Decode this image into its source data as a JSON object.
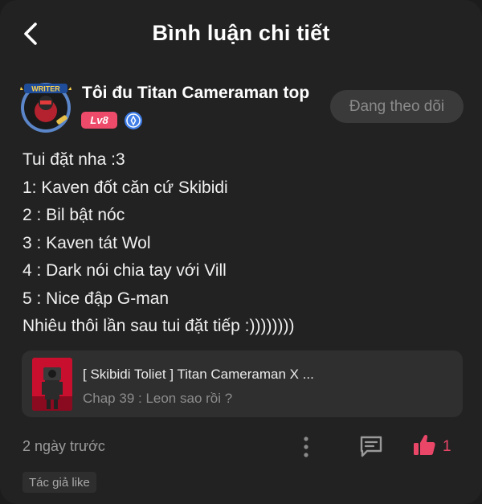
{
  "header": {
    "title": "Bình luận chi tiết"
  },
  "user": {
    "name": "Tôi đu Titan Cameraman top",
    "level": "Lv8",
    "follow_label": "Đang theo dõi",
    "avatar_banner": "WRITER"
  },
  "comment": {
    "lines": [
      "Tui đặt nha :3",
      "1: Kaven đốt căn cứ Skibidi",
      "2 : Bil bật nóc",
      "3 : Kaven tát Wol",
      "4 : Dark nói chia tay với Vill",
      "5 : Nice đập G-man",
      "Nhiêu thôi lần sau tui đặt tiếp :))))))))"
    ],
    "timestamp": "2 ngày trước",
    "likes": "1",
    "author_like": "Tác giả like"
  },
  "story_card": {
    "title": "[ Skibidi Toliet ] Titan Cameraman X ...",
    "chapter": "Chap 39 : Leon sao rồi ?"
  },
  "colors": {
    "background": "#222222",
    "accent_pink": "#ee4a6a",
    "like_pink": "#ea4668",
    "verify_blue": "#3f7ee8"
  },
  "icons": [
    "back-icon",
    "verified-icon",
    "more-icon",
    "comment-icon",
    "like-icon"
  ]
}
